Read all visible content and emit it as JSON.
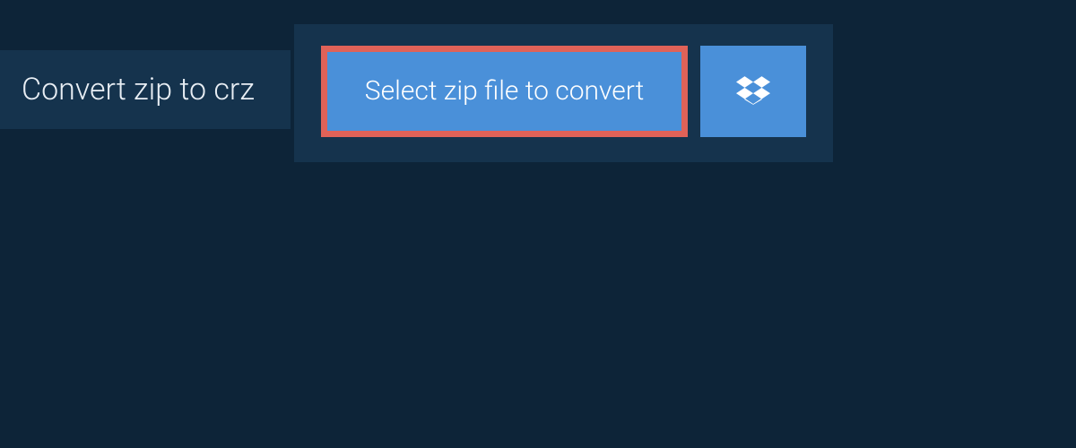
{
  "tab": {
    "title": "Convert zip to crz"
  },
  "actions": {
    "select_file_label": "Select zip file to convert"
  }
}
